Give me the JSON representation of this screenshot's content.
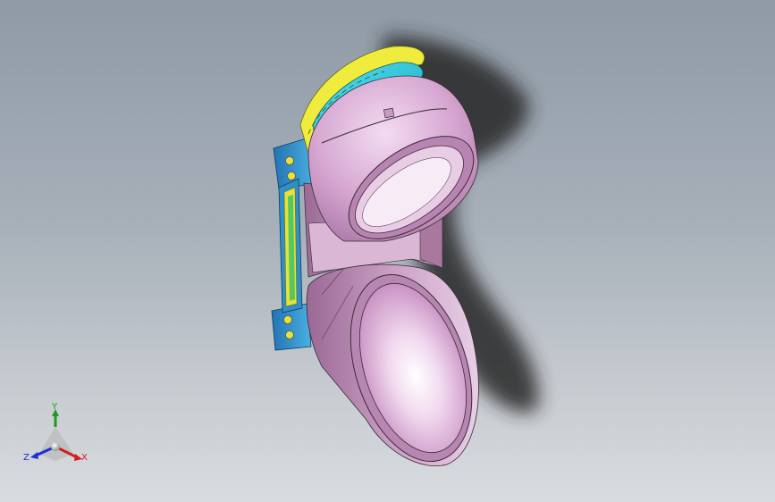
{
  "viewport": {
    "background_top": "#8f9aa6",
    "background_bottom": "#d9dcdf"
  },
  "model": {
    "body_color": "#c98fc4",
    "bracket_color": "#2f8fc7",
    "frame_color": "#e6e23a",
    "frame_accent": "#2fc7d9",
    "shadow_color": "#2b2b2b"
  },
  "triad": {
    "x_label": "X",
    "y_label": "Y",
    "z_label": "Z",
    "x_color": "#d11f1f",
    "y_color": "#1f9a1f",
    "z_color": "#1f2fd1"
  }
}
